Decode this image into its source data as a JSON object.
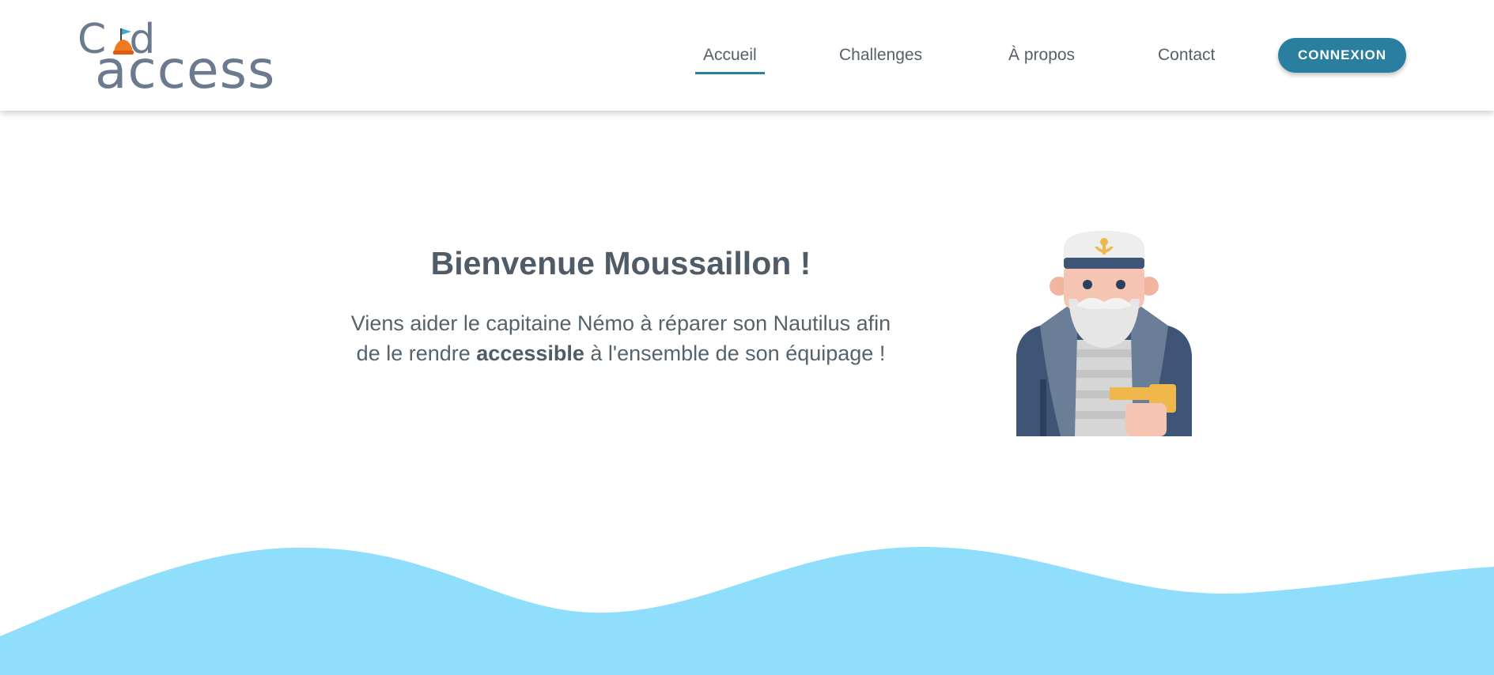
{
  "header": {
    "logo": {
      "line1": "Cod",
      "line2": "access"
    },
    "nav": [
      {
        "label": "Accueil",
        "active": true
      },
      {
        "label": "Challenges",
        "active": false
      },
      {
        "label": "À propos",
        "active": false
      },
      {
        "label": "Contact",
        "active": false
      }
    ],
    "connexion_label": "CONNEXION"
  },
  "hero": {
    "title": "Bienvenue Moussaillon !",
    "text_before": "Viens aider le capitaine Némo à réparer son Nautilus afin de le rendre ",
    "text_bold": "accessible",
    "text_after": " à l'ensemble de son équipage !"
  },
  "colors": {
    "accent": "#2a7fa0",
    "wave": "#8fdefc",
    "text": "#4f5b66"
  }
}
